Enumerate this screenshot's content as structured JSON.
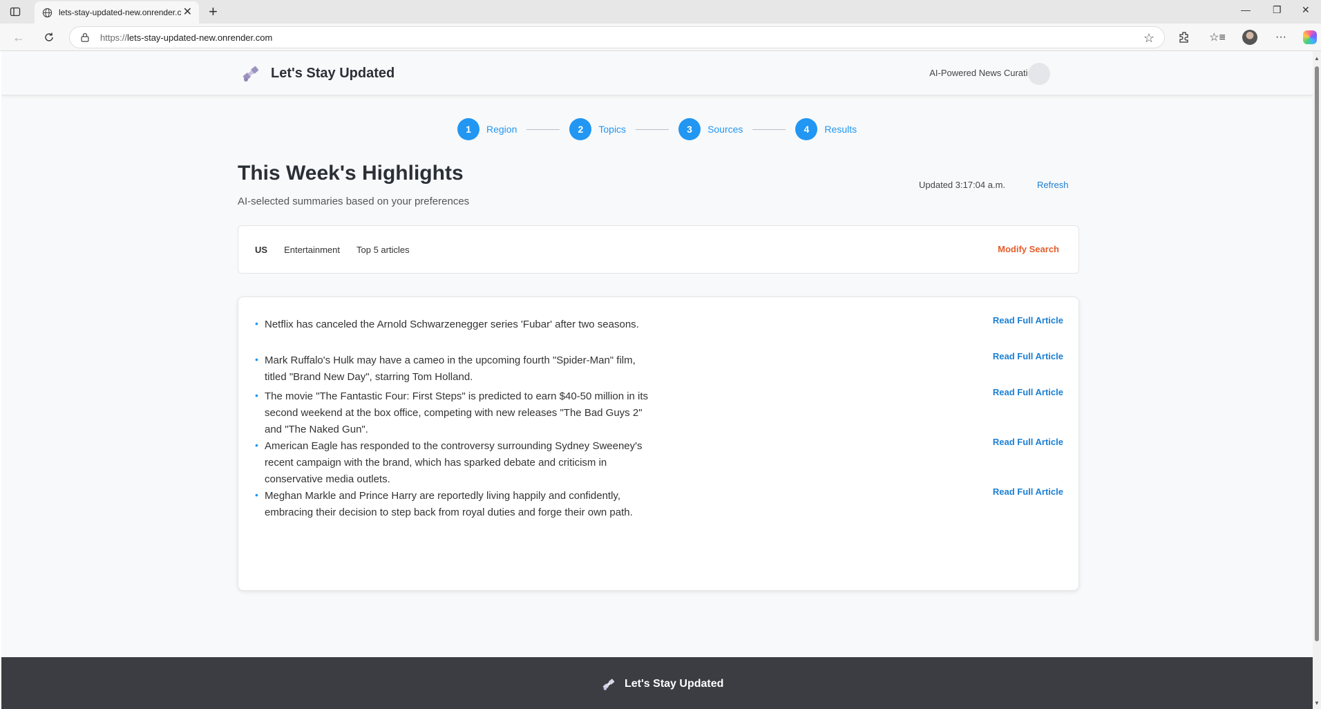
{
  "browser": {
    "tab_title": "lets-stay-updated-new.onrender.com",
    "url_protocol": "https://",
    "url_host": "lets-stay-updated-new.onrender.com"
  },
  "site": {
    "brand": "Let's Stay Updated",
    "tagline": "AI-Powered News Curation",
    "footer_brand": "Let's Stay Updated"
  },
  "stepper": [
    {
      "num": "1",
      "label": "Region"
    },
    {
      "num": "2",
      "label": "Topics"
    },
    {
      "num": "3",
      "label": "Sources"
    },
    {
      "num": "4",
      "label": "Results"
    }
  ],
  "main": {
    "title": "This Week's Highlights",
    "subtitle": "AI-selected summaries based on your preferences",
    "updated": "Updated 3:17:04 a.m.",
    "refresh_label": "Refresh"
  },
  "filters": {
    "region": "US",
    "topic": "Entertainment",
    "count": "Top 5 articles",
    "modify_label": "Modify Search"
  },
  "articles": [
    {
      "text": "Netflix has canceled the Arnold Schwarzenegger series 'Fubar' after two seasons.",
      "link": "Read Full Article"
    },
    {
      "text": "Mark Ruffalo's Hulk may have a cameo in the upcoming fourth \"Spider-Man\" film, titled \"Brand New Day\", starring Tom Holland.",
      "link": "Read Full Article"
    },
    {
      "text": "The movie \"The Fantastic Four: First Steps\" is predicted to earn $40-50 million in its second weekend at the box office, competing with new releases \"The Bad Guys 2\" and \"The Naked Gun\".",
      "link": "Read Full Article"
    },
    {
      "text": "American Eagle has responded to the controversy surrounding Sydney Sweeney's recent campaign with the brand, which has sparked debate and criticism in conservative media outlets.",
      "link": "Read Full Article"
    },
    {
      "text": "Meghan Markle and Prince Harry are reportedly living happily and confidently, embracing their decision to step back from royal duties and forge their own path.",
      "link": "Read Full Article"
    }
  ],
  "colors": {
    "accent": "#2196f3",
    "link": "#1a7fd4",
    "modify": "#e35d2b",
    "footer": "#3b3d42"
  }
}
